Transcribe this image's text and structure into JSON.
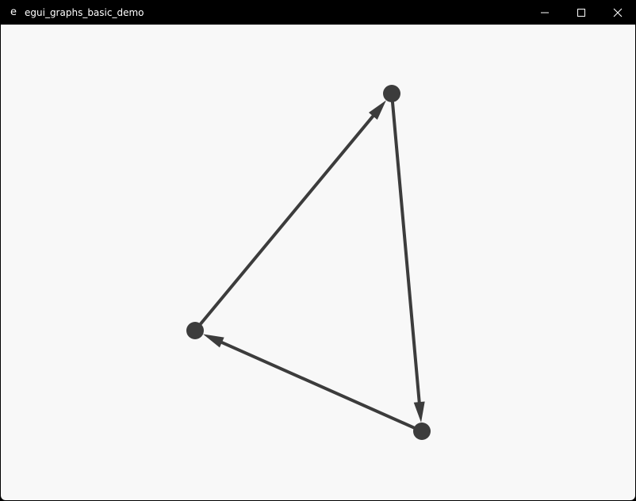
{
  "window": {
    "title": "egui_graphs_basic_demo",
    "app_icon_glyph": "e"
  },
  "controls": {
    "minimize_icon": "minimize-icon",
    "maximize_icon": "maximize-icon",
    "close_icon": "close-icon"
  },
  "graph": {
    "node_color": "#3c3c3c",
    "edge_color": "#3c3c3c",
    "background": "#f8f8f8",
    "nodes": [
      {
        "id": "node-a"
      },
      {
        "id": "node-b"
      },
      {
        "id": "node-c"
      }
    ],
    "edges": [
      {
        "from": "node-a",
        "to": "node-b"
      },
      {
        "from": "node-b",
        "to": "node-c"
      },
      {
        "from": "node-c",
        "to": "node-a"
      }
    ]
  }
}
